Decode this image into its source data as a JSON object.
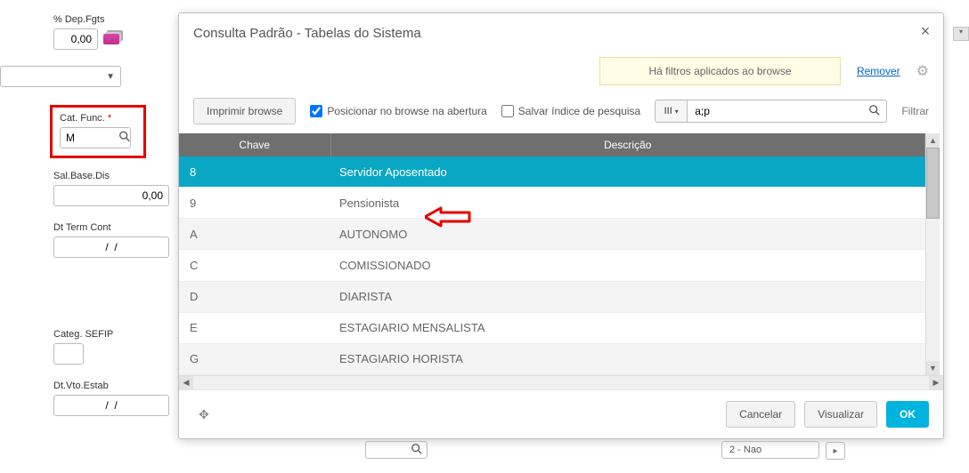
{
  "left": {
    "dep_fgts_label": "% Dep.Fgts",
    "dep_fgts_value": "0,00",
    "cat_func_label": "Cat. Func.",
    "cat_func_value": "M",
    "sal_base_label": "Sal.Base.Dis",
    "sal_base_value": "0,00",
    "dt_term_label": "Dt Term Cont",
    "dt_term_value": "/  /",
    "sefip_label": "Categ. SEFIP",
    "dt_vto_label": "Dt.Vto.Estab",
    "dt_vto_value": "/  /"
  },
  "modal": {
    "title": "Consulta Padrão - Tabelas do Sistema",
    "filter_msg": "Há filtros aplicados ao browse",
    "remove": "Remover",
    "print": "Imprimir browse",
    "chk_position": "Posicionar no browse na abertura",
    "chk_save": "Salvar índice de pesquisa",
    "search_value": "a;p",
    "mode_label": "III",
    "filtrar": "Filtrar",
    "col_key": "Chave",
    "col_desc": "Descrição",
    "rows": [
      {
        "k": "8",
        "d": "Servidor Aposentado"
      },
      {
        "k": "9",
        "d": "Pensionista"
      },
      {
        "k": "A",
        "d": "AUTONOMO"
      },
      {
        "k": "C",
        "d": "COMISSIONADO"
      },
      {
        "k": "D",
        "d": "DIARISTA"
      },
      {
        "k": "E",
        "d": "ESTAGIARIO MENSALISTA"
      },
      {
        "k": "G",
        "d": "ESTAGIARIO HORISTA"
      }
    ],
    "cancel": "Cancelar",
    "view": "Visualizar",
    "ok": "OK"
  },
  "below": {
    "opt": "2 - Nao"
  }
}
